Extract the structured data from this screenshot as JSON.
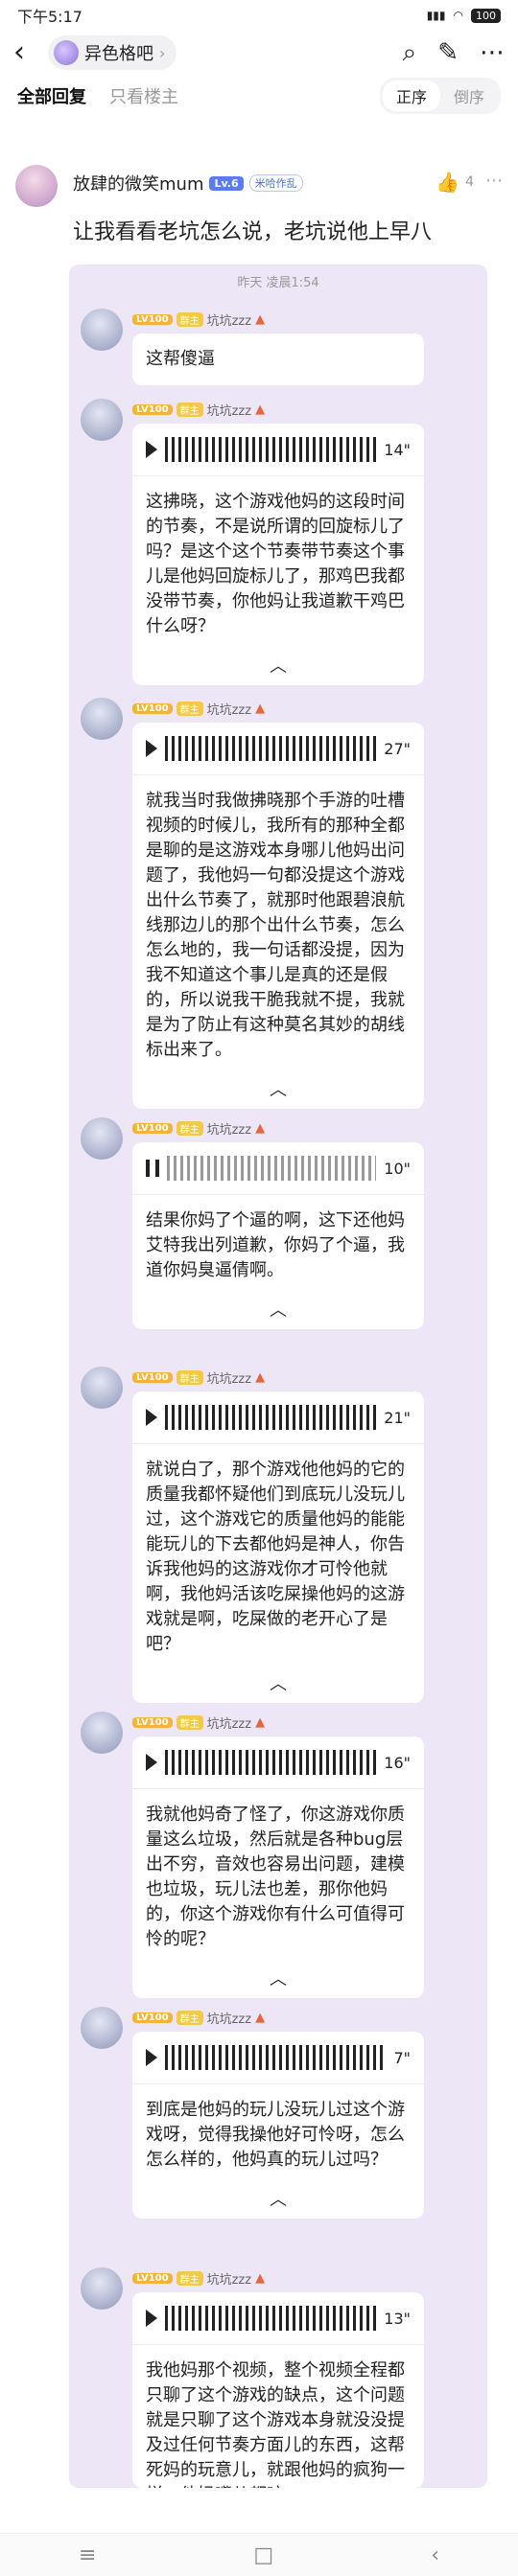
{
  "status": {
    "time": "下午5:17",
    "battery": "100"
  },
  "topbar": {
    "forum_name": "异色格吧"
  },
  "tabs": {
    "all": "全部回复",
    "owner_only": "只看楼主",
    "sort_asc": "正序",
    "sort_desc": "倒序"
  },
  "post": {
    "author": "放肆的微笑mum",
    "level": "Lv.6",
    "tag": "米哈作乱",
    "likes": "4",
    "text": "让我看看老坑怎么说，老坑说他上早八"
  },
  "thread": {
    "timestamp": "昨天 凌晨1:54"
  },
  "replies": [
    {
      "user": "坑坑zzz",
      "lv": "LV100",
      "badge": "群主",
      "text": "这帮傻逼"
    },
    {
      "user": "坑坑zzz",
      "lv": "LV100",
      "badge": "群主",
      "duration": "14\"",
      "text": "这拂晓，这个游戏他妈的这段时间的节奏，不是说所谓的回旋标儿了吗？是这个这个节奏带节奏这个事儿是他妈回旋标儿了，那鸡巴我都没带节奏，你他妈让我道歉干鸡巴什么呀？"
    },
    {
      "user": "坑坑zzz",
      "lv": "LV100",
      "badge": "群主",
      "duration": "27\"",
      "text": "就我当时我做拂晓那个手游的吐槽视频的时候儿，我所有的那种全都是聊的是这游戏本身哪儿他妈出问题了，我他妈一句都没提这个游戏出什么节奏了，就那时他跟碧浪航线那边儿的那个出什么节奏，怎么怎么地的，我一句话都没提，因为我不知道这个事儿是真的还是假的，所以说我干脆我就不提，我就是为了防止有这种莫名其妙的胡线标出来了。"
    },
    {
      "user": "坑坑zzz",
      "lv": "LV100",
      "badge": "群主",
      "duration": "10\"",
      "text": "结果你妈了个逼的啊，这下还他妈艾特我出列道歉，你妈了个逼，我道你妈臭逼倩啊。"
    },
    {
      "user": "坑坑zzz",
      "lv": "LV100",
      "badge": "群主",
      "duration": "21\"",
      "text": "就说白了，那个游戏他他妈的它的质量我都怀疑他们到底玩儿没玩儿过，这个游戏它的质量他妈的能能能玩儿的下去都他妈是神人，你告诉我他妈的这游戏你才可怜他就啊，我他妈活该吃屎操他妈的这游戏就是啊，吃屎做的老开心了是吧？"
    },
    {
      "user": "坑坑zzz",
      "lv": "LV100",
      "badge": "群主",
      "duration": "16\"",
      "text": "我就他妈奇了怪了，你这游戏你质量这么垃圾，然后就是各种bug层出不穷，音效也容易出问题，建模也垃圾，玩儿法也差，那你他妈的，你这个游戏你有什么可值得可怜的呢？"
    },
    {
      "user": "坑坑zzz",
      "lv": "LV100",
      "badge": "群主",
      "duration": "7\"",
      "text": "到底是他妈的玩儿没玩儿过这个游戏呀，觉得我操他好可怜呀，怎么怎么样的，他妈真的玩儿过吗？"
    },
    {
      "user": "坑坑zzz",
      "lv": "LV100",
      "badge": "群主",
      "duration": "13\"",
      "text": "我他妈那个视频，整个视频全程都只聊了这个游戏的缺点，这个问题就是只聊了这个游戏本身就没没提及过任何节奏方面儿的东西，这帮死妈的玩意儿，就跟他妈的疯狗一样，他妈嘴儿都咬"
    }
  ]
}
